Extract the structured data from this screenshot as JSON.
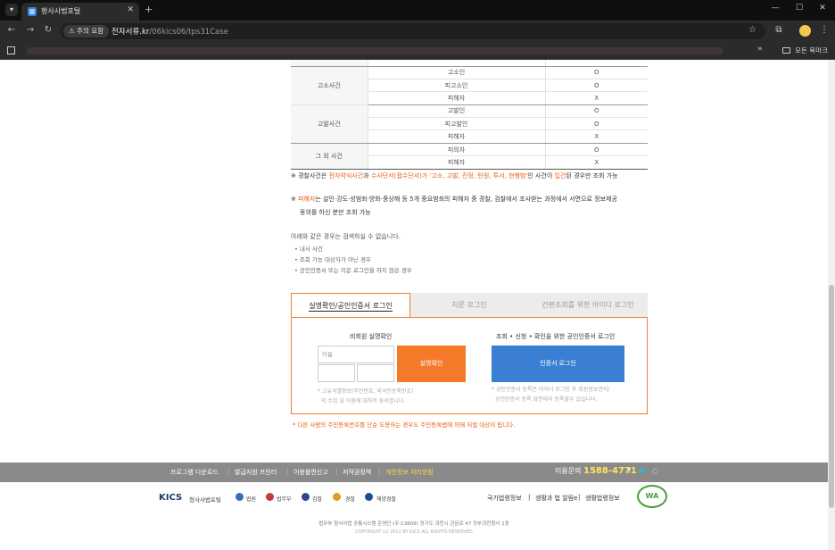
{
  "browser": {
    "tab_title": "형사사법포털",
    "security_chip": "⚠ 주의 요함",
    "host": "전자서류.kr",
    "path": "/06kics06/tps31Case",
    "bookmarks_all": "모든 북마크"
  },
  "table": {
    "rows": [
      {
        "category": "",
        "role": "",
        "mark": ""
      },
      {
        "category": "고소사건",
        "role": "고소인",
        "mark": "O"
      },
      {
        "category": "",
        "role": "피고소인",
        "mark": "O"
      },
      {
        "category": "",
        "role": "피해자",
        "mark": "X"
      },
      {
        "category": "고발사건",
        "role": "고발인",
        "mark": "O"
      },
      {
        "category": "",
        "role": "피고발인",
        "mark": "O"
      },
      {
        "category": "",
        "role": "피해자",
        "mark": "X"
      },
      {
        "category": "그 외 사건",
        "role": "피의자",
        "mark": "O"
      },
      {
        "category": "",
        "role": "피해자",
        "mark": "X"
      }
    ]
  },
  "notes": {
    "note1_prefix": "※  경찰사건은 ",
    "note1_hl1": "전자약식사건",
    "note1_mid": "과 ",
    "note1_hl2": "수사단서(접수단서)가 '고소, 고발, 진정, 탄원, 투서, 현행범'",
    "note1_mid2": "인 사건이 ",
    "note1_hl3": "입건",
    "note1_suffix": "된 경우만 조회 가능",
    "note2_prefix": "※  ",
    "note2_hl": "피해자",
    "note2_suffix": "는 살인·강도·성범죄·방화·중상해 등 5개 중요범죄의 피해자 중 경찰, 검찰에서 조사받는 과정에서 서면으로 정보제공",
    "note2_line2": "동의를 하신 분만 조회 가능",
    "cond_title": "아래와 같은 경우는 검색하실 수 없습니다.",
    "cond_items": [
      "•  내사 사건",
      "•  조회 가능 대상자가 아닌 경우",
      "•  공인인증서 또는 지문 로그인을 하지 않은 경우"
    ]
  },
  "login": {
    "tabs": [
      "실명확인/공인인증서 로그인",
      "지문 로그인",
      "간편조회를 위한 아이디 로그인"
    ],
    "left_title": "비회원 실명확인",
    "name_placeholder": "이름",
    "verify_button": "실명확인",
    "left_note1": "* 고유식별정보(주민번호, 외국인등록번호)",
    "left_note2": "의 수집 및 이용에 대하여 동의합니다.",
    "right_title": "조회 • 신청 • 확인을 위한 공인인증서 로그인",
    "cert_button": "인증서 로그인",
    "right_note1": "* 공인인증서 등록은 아이디 로그인 후 회원정보관리/",
    "right_note2": "공인인증서 등록 화면에서 등록할수 있습니다.",
    "warning": "*  다른 사람의 주민등록번호를 단순 도용하는 경우도 주민등록법에 의해 처벌 대상이 됩니다."
  },
  "footer": {
    "nav": [
      "프로그램 다운로드",
      "발급지원 프린터",
      "이용불편신고",
      "저작권정책",
      "개인정보 처리방침"
    ],
    "help_label": "이용문의",
    "help_number": "1588-4771",
    "kics": "KICS",
    "kics_sub": "형사사법포털",
    "orgs": [
      "법원",
      "법무부",
      "검찰",
      "경찰",
      "해양경찰"
    ],
    "links": [
      "국가법령정보",
      "생활과 법 알림e",
      "생활법령정보"
    ],
    "wa_badge": "WA",
    "address": "법무부 형사사법 공통시스템 운영단 (우:13809) 경기도 과천시 관문로 47 정부과천청사 1동",
    "copyright": "COPYRIGHT (c) 2012 BY KICS ALL RIGHTS RESERVED"
  },
  "colors": {
    "accent_orange": "#f47a2a",
    "accent_blue": "#3b7fd4",
    "highlight_orange": "#e85c0d",
    "footer_gray": "#8a8a8a",
    "help_yellow": "#ffe45c"
  }
}
